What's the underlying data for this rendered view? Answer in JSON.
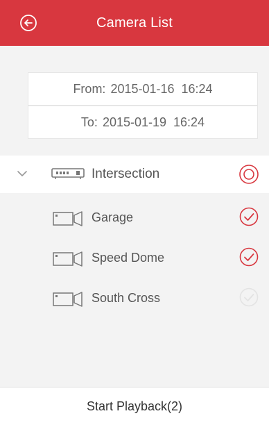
{
  "header": {
    "title": "Camera List",
    "back_icon": "back-arrow-circle-icon"
  },
  "time_range": {
    "from": {
      "label": "From:",
      "date": "2015-01-16",
      "time": "16:24"
    },
    "to": {
      "label": "To:",
      "date": "2015-01-19",
      "time": "16:24"
    }
  },
  "device": {
    "name": "Intersection",
    "icon": "dvr-device-icon",
    "expanded": true,
    "selection": "partial"
  },
  "cameras": [
    {
      "name": "Garage",
      "icon": "camera-icon",
      "selected": true
    },
    {
      "name": "Speed Dome",
      "icon": "camera-icon",
      "selected": true
    },
    {
      "name": "South Cross",
      "icon": "camera-icon",
      "selected": false
    }
  ],
  "footer": {
    "action_label": "Start Playback(2)"
  },
  "colors": {
    "accent": "#d8373f",
    "background": "#f3f3f3",
    "check_inactive": "#e3e3e3"
  }
}
